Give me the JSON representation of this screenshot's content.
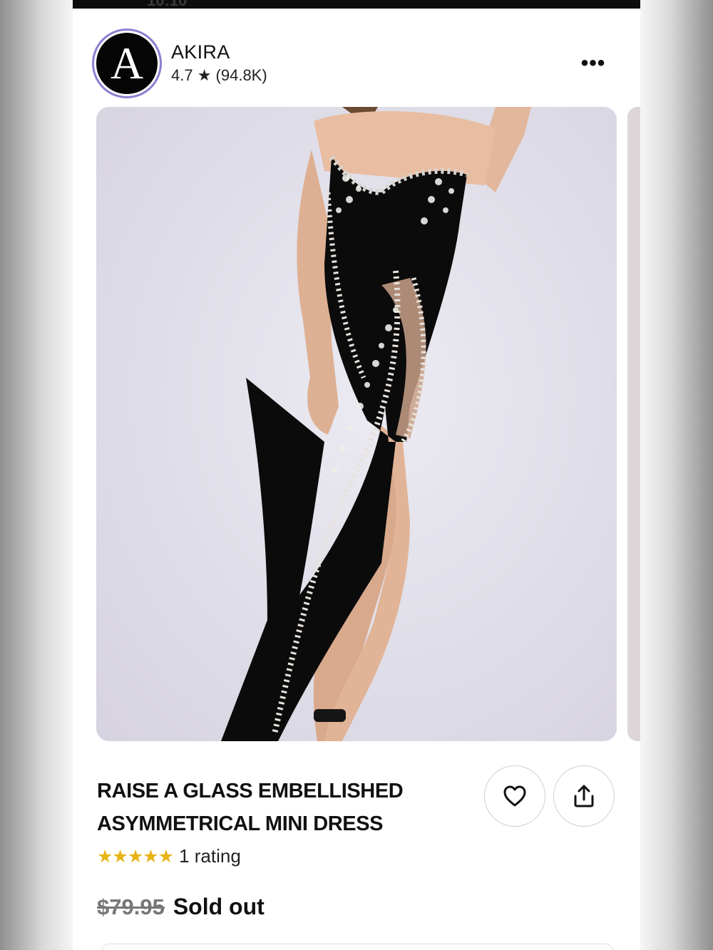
{
  "status_bar": {
    "time": "10:10"
  },
  "store": {
    "avatar_letter": "A",
    "name": "AKIRA",
    "rating": "4.7 ★ (94.8K)"
  },
  "header": {
    "more_label": "•••"
  },
  "product": {
    "title_line1": "RAISE A GLASS EMBELLISHED",
    "title_line2": "ASYMMETRICAL MINI DRESS",
    "stars": "★★★★★",
    "rating_text": "1 rating",
    "original_price": "$79.95",
    "availability": "Sold out"
  },
  "icons": [
    "close-icon",
    "heart-icon",
    "share-icon",
    "more-icon"
  ],
  "colors": {
    "star": "#e7b416",
    "avatar_ring": "#8c7fd0",
    "dress": "#0b0b0b",
    "background": "#e2e0e8"
  }
}
